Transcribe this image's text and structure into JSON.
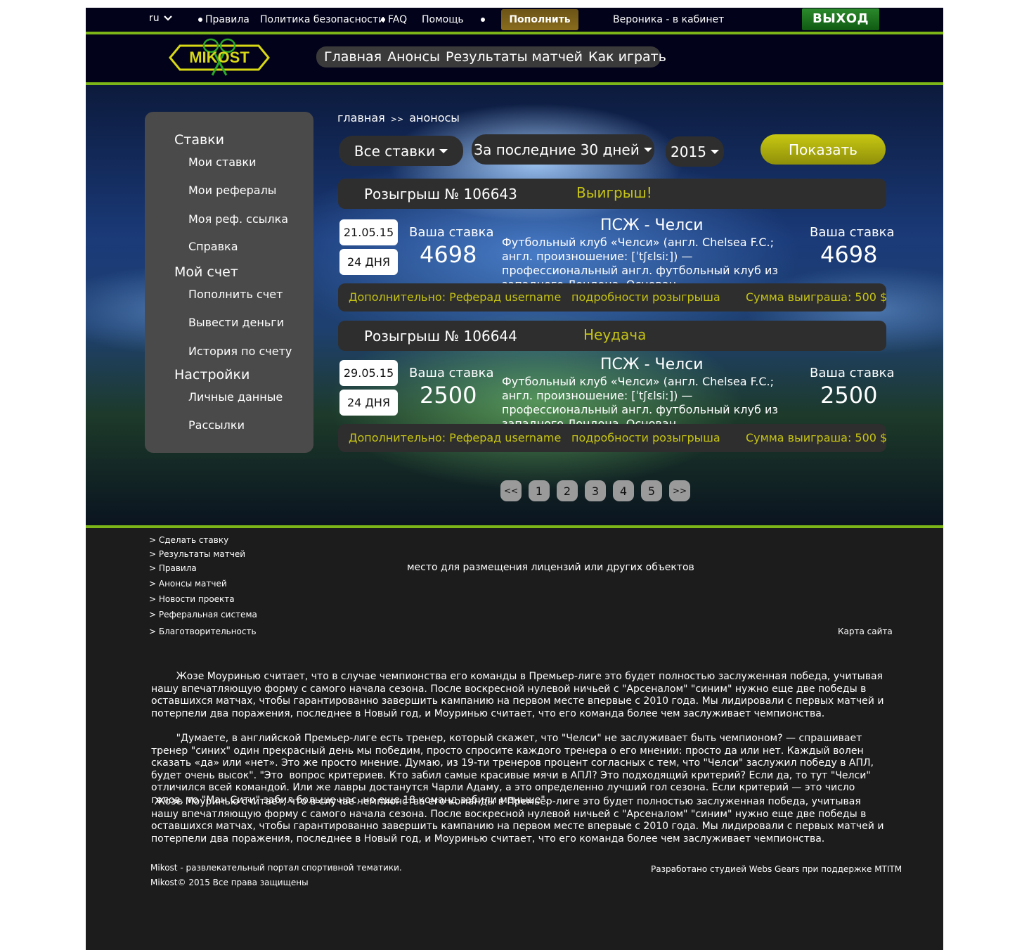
{
  "topbar": {
    "lang": "ru",
    "links": [
      "Правила",
      "Политика безопасности",
      "FAQ",
      "Помощь"
    ],
    "topup_label": "Пополнить",
    "user_label": "Вероника - в кабинет",
    "exit_label": "ВЫХОД"
  },
  "header": {
    "logo_text": "MIKOST",
    "nav": [
      "Главная",
      "Анонсы",
      "Результаты матчей",
      "Как играть"
    ]
  },
  "sidebar": {
    "sections": [
      {
        "title": "Ставки",
        "items": [
          "Мои ставки",
          "Мои рефералы",
          "Моя реф. ссылка",
          "Справка"
        ]
      },
      {
        "title": "Мой счет",
        "items": [
          "Пополнить счет",
          "Вывести деньги",
          "История по счету"
        ]
      },
      {
        "title": "Настройки",
        "items": [
          "Личные данные",
          "Рассылки"
        ]
      }
    ]
  },
  "breadcrumb": {
    "home": "главная",
    "sep": ">>",
    "current": "аноносы"
  },
  "filters": {
    "bets": "Все ставки",
    "period": "За последние 30 дней",
    "year": "2015",
    "show_label": "Показать"
  },
  "draws": [
    {
      "title": "Розыгрыш № 106643",
      "result": "Выигрыш!",
      "date": "21.05.15",
      "days": "24 ДНЯ",
      "stake_label_left": "Ваша ставка",
      "stake_left": "4698",
      "match": "ПСЖ - Челси",
      "desc": "Футбольный клуб «Челси» (англ. Chelsea F.C.; англ. произношение: [ˈtʃɛlsiː]) — профессиональный англ. футбольный клуб из западного Лондона. Основан.",
      "stake_label_right": "Ваша ставка",
      "stake_right": "4698",
      "extra": "Дополнительно: Реферад username",
      "details": "подробности розыгрыша",
      "sum": "Сумма выиграша: 500 $"
    },
    {
      "title": "Розыгрыш № 106644",
      "result": "Неудача",
      "date": "29.05.15",
      "days": "24 ДНЯ",
      "stake_label_left": "Ваша ставка",
      "stake_left": "2500",
      "match": "ПСЖ - Челси",
      "desc": "Футбольный клуб «Челси» (англ. Chelsea F.C.; англ. произношение: [ˈtʃɛlsiː]) — профессиональный англ. футбольный клуб из западного Лондона. Основан.",
      "stake_label_right": "Ваша ставка",
      "stake_right": "2500",
      "extra": "Дополнительно: Реферад username",
      "details": "подробности розыгрыша",
      "sum": "Сумма выиграша: 500 $"
    }
  ],
  "pagination": [
    "<<",
    "1",
    "2",
    "3",
    "4",
    "5",
    ">>"
  ],
  "footer": {
    "links": [
      "> Сделать ставку",
      "> Результаты матчей",
      "> Правила",
      "> Анонсы матчей",
      "> Новости проекта",
      "> Реферальная система",
      "> Благотворительность"
    ],
    "license": "место для размещения лицензий или других объектов",
    "sitemap": "Карта сайта",
    "para1": "        Жозе Моуринью считает, что в случае чемпионства его команды в Премьер-лиге это будет полностью заслуженная победа, учитывая нашу впечатляющую форму с самого начала сезона. После воскресной нулевой ничьей с \"Арсеналом\" \"синим\" нужно еще две победы в оставшихся матчах, чтобы гарантированно завершить кампанию на первом месте впервые с 2010 года. Мы лидировали с первых матчей и потерпели два поражения, последнее в Новый год, и Моуринью считает, что его команда более чем заслуживает чемпионства.",
    "para2": "        \"Думаете, в английской Премьер-лиге есть тренер, который скажет, что \"Челси\" не заслуживает быть чемпионом? — спрашивает тренер \"синих\" один прекрасный день мы победим, просто спросите каждого тренера о его мнении: просто да или нет. Каждый волен сказать «да» или «нет». Это же просто мнение. Думаю, из 19-ти тренеров процент согласных с тем, что \"Челси\" заслужил победу в АПЛ, будет очень высок\". \"Это  вопрос критериев. Кто забил самые красивые мячи в АПЛ? Это подходящий критерий? Если да, то тут \"Челси\" отличился всей командой. Или же лавры достанутся Чарли Адаму, а это определенно лучший гол сезона. Если критерий — это число голов, то \"Ман Сити\" забил больше нас, но еще 18 команд забили меньше\".",
    "para3": " Жозе Моуринью считает, что в случае чемпионства его команды в Премьер-лиге это будет полностью заслуженная победа, учитывая нашу впечатляющую форму с самого начала сезона. После воскресной нулевой ничьей с \"Арсеналом\" \"синим\" нужно еще две победы в оставшихся матчах, чтобы гарантированно завершить кампанию на первом месте впервые с 2010 года. Мы лидировали с первых матчей и потерпели два поражения, последнее в Новый год, и Моуринью считает, что его команда более чем заслуживает чемпионства.",
    "copy1": "Mikost - развлекательный портал спортивной тематики.",
    "copy2": "Mikost© 2015 Все права защищены",
    "dev": "Разработано студией Webs Gears при поддержке MTITM"
  }
}
